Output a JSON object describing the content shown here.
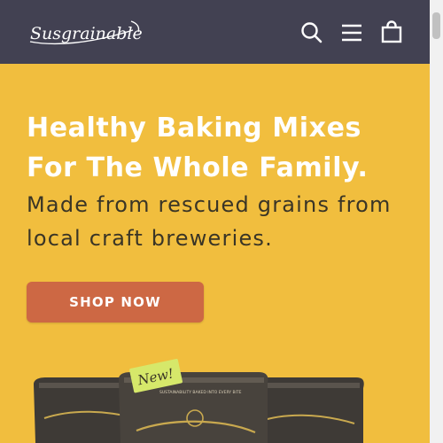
{
  "header": {
    "logo_text": "Susgrainable",
    "icons": {
      "search": "search-icon",
      "menu": "hamburger-menu-icon",
      "cart": "cart-bag-icon"
    }
  },
  "hero": {
    "title_lines": [
      "Healthy Baking Mixes",
      "For The Whole Family."
    ],
    "subtitle_lines": [
      "Made from rescued grains from",
      "local craft breweries."
    ],
    "cta_label": "SHOP NOW",
    "badge_text": "New!",
    "product_label_text": "SUSTAINABILITY BAKED INTO EVERY BITE"
  },
  "colors": {
    "header_bg": "#424152",
    "hero_bg": "#F1BE3E",
    "title_color": "#FFFFFF",
    "subtitle_color": "#3A3526",
    "cta_bg": "#CD6844",
    "badge_bg": "#D6E86A"
  }
}
